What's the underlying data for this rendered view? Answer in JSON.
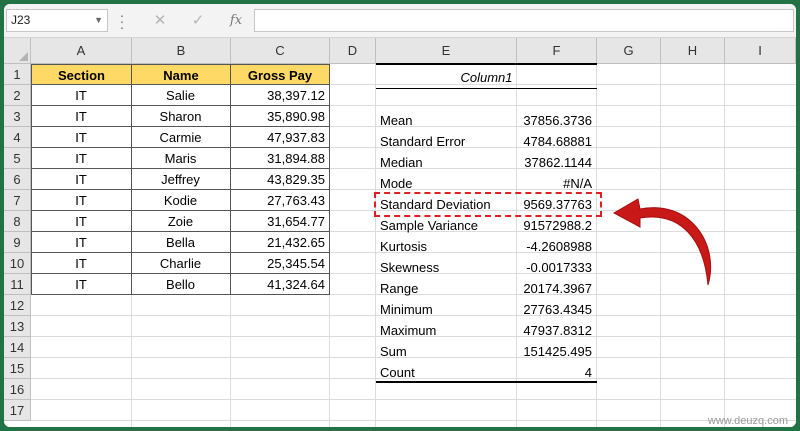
{
  "name_box": "J23",
  "formula_bar": {
    "cancel_icon": "✕",
    "enter_icon": "✓",
    "fx_label": "fx",
    "content": ""
  },
  "columns": [
    "A",
    "B",
    "C",
    "D",
    "E",
    "F",
    "G",
    "H",
    "I"
  ],
  "rows": [
    "1",
    "2",
    "3",
    "4",
    "5",
    "6",
    "7",
    "8",
    "9",
    "10",
    "11",
    "12",
    "13",
    "14",
    "15",
    "16",
    "17"
  ],
  "table": {
    "headers": [
      "Section",
      "Name",
      "Gross Pay"
    ],
    "rows": [
      [
        "IT",
        "Salie",
        "38,397.12"
      ],
      [
        "IT",
        "Sharon",
        "35,890.98"
      ],
      [
        "IT",
        "Carmie",
        "47,937.83"
      ],
      [
        "IT",
        "Maris",
        "31,894.88"
      ],
      [
        "IT",
        "Jeffrey",
        "43,829.35"
      ],
      [
        "IT",
        "Kodie",
        "27,763.43"
      ],
      [
        "IT",
        "Zoie",
        "31,654.77"
      ],
      [
        "IT",
        "Bella",
        "21,432.65"
      ],
      [
        "IT",
        "Charlie",
        "25,345.54"
      ],
      [
        "IT",
        "Bello",
        "41,324.64"
      ]
    ]
  },
  "stats": {
    "title": "Column1",
    "rows": [
      [
        "Mean",
        "37856.3736"
      ],
      [
        "Standard Error",
        "4784.68881"
      ],
      [
        "Median",
        "37862.1144"
      ],
      [
        "Mode",
        "#N/A"
      ],
      [
        "Standard Deviation",
        "9569.37763"
      ],
      [
        "Sample Variance",
        "91572988.2"
      ],
      [
        "Kurtosis",
        "-4.2608988"
      ],
      [
        "Skewness",
        "-0.0017333"
      ],
      [
        "Range",
        "20174.3967"
      ],
      [
        "Minimum",
        "27763.4345"
      ],
      [
        "Maximum",
        "47937.8312"
      ],
      [
        "Sum",
        "151425.495"
      ],
      [
        "Count",
        "4"
      ]
    ]
  },
  "watermark": "www.deuzq.com",
  "colors": {
    "header_fill": "#ffd966",
    "highlight": "#e02020",
    "arrow": "#c81818",
    "border": "#217346"
  }
}
